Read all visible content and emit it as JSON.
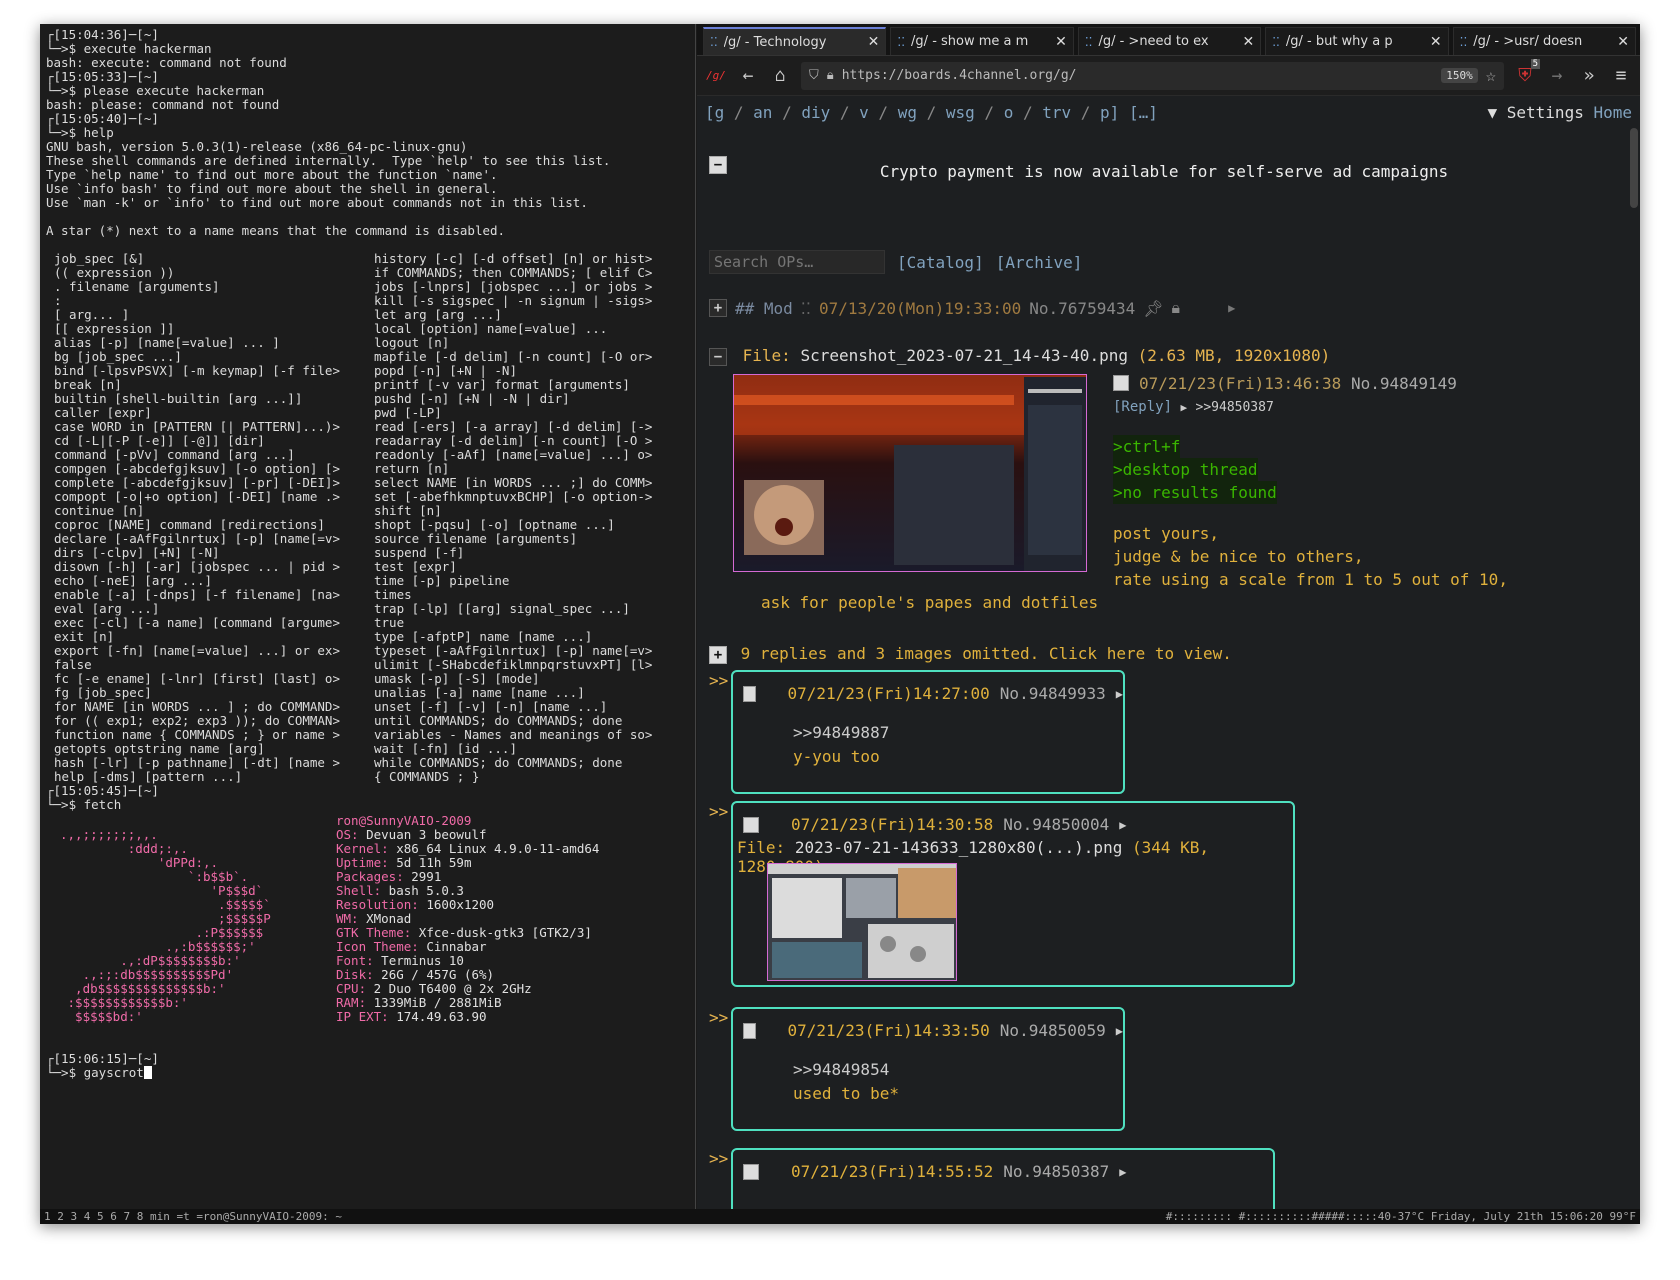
{
  "terminal": {
    "lines_top": [
      {
        "kind": "prompt",
        "text": "┌[15:04:36]─[~]"
      },
      {
        "kind": "cmd",
        "text": "└─>$ execute hackerman"
      },
      {
        "kind": "out",
        "text": "bash: execute: command not found"
      },
      {
        "kind": "prompt",
        "text": "┌[15:05:33]─[~]"
      },
      {
        "kind": "cmd",
        "text": "└─>$ please execute hackerman"
      },
      {
        "kind": "out",
        "text": "bash: please: command not found"
      },
      {
        "kind": "prompt",
        "text": "┌[15:05:40]─[~]"
      },
      {
        "kind": "cmd",
        "text": "└─>$ help"
      },
      {
        "kind": "out",
        "text": "GNU bash, version 5.0.3(1)-release (x86_64-pc-linux-gnu)"
      },
      {
        "kind": "out",
        "text": "These shell commands are defined internally.  Type `help' to see this list."
      },
      {
        "kind": "out",
        "text": "Type `help name' to find out more about the function `name'."
      },
      {
        "kind": "out",
        "text": "Use `info bash' to find out more about the shell in general."
      },
      {
        "kind": "out",
        "text": "Use `man -k' or `info' to find out more about commands not in this list."
      },
      {
        "kind": "out",
        "text": ""
      },
      {
        "kind": "out",
        "text": "A star (*) next to a name means that the command is disabled."
      },
      {
        "kind": "out",
        "text": ""
      }
    ],
    "help_left": [
      "job_spec [&]",
      "(( expression ))",
      ". filename [arguments]",
      ":",
      "[ arg... ]",
      "[[ expression ]]",
      "alias [-p] [name[=value] ... ]",
      "bg [job_spec ...]",
      "bind [-lpsvPSVX] [-m keymap] [-f file>",
      "break [n]",
      "builtin [shell-builtin [arg ...]]",
      "caller [expr]",
      "case WORD in [PATTERN [| PATTERN]...)>",
      "cd [-L|[-P [-e]] [-@]] [dir]",
      "command [-pVv] command [arg ...]",
      "compgen [-abcdefgjksuv] [-o option] [>",
      "complete [-abcdefgjksuv] [-pr] [-DEI]>",
      "compopt [-o|+o option] [-DEI] [name .>",
      "continue [n]",
      "coproc [NAME] command [redirections]",
      "declare [-aAfFgilnrtux] [-p] [name[=v>",
      "dirs [-clpv] [+N] [-N]",
      "disown [-h] [-ar] [jobspec ... | pid >",
      "echo [-neE] [arg ...]",
      "enable [-a] [-dnps] [-f filename] [na>",
      "eval [arg ...]",
      "exec [-cl] [-a name] [command [argume>",
      "exit [n]",
      "export [-fn] [name[=value] ...] or ex>",
      "false",
      "fc [-e ename] [-lnr] [first] [last] o>",
      "fg [job_spec]",
      "for NAME [in WORDS ... ] ; do COMMAND>",
      "for (( exp1; exp2; exp3 )); do COMMAN>",
      "function name { COMMANDS ; } or name >",
      "getopts optstring name [arg]",
      "hash [-lr] [-p pathname] [-dt] [name >",
      "help [-dms] [pattern ...]"
    ],
    "help_right": [
      "history [-c] [-d offset] [n] or hist>",
      "if COMMANDS; then COMMANDS; [ elif C>",
      "jobs [-lnprs] [jobspec ...] or jobs >",
      "kill [-s sigspec | -n signum | -sigs>",
      "let arg [arg ...]",
      "local [option] name[=value] ...",
      "logout [n]",
      "mapfile [-d delim] [-n count] [-O or>",
      "popd [-n] [+N | -N]",
      "printf [-v var] format [arguments]",
      "pushd [-n] [+N | -N | dir]",
      "pwd [-LP]",
      "read [-ers] [-a array] [-d delim] [->",
      "readarray [-d delim] [-n count] [-O >",
      "readonly [-aAf] [name[=value] ...] o>",
      "return [n]",
      "select NAME [in WORDS ... ;] do COMM>",
      "set [-abefhkmnptuvxBCHP] [-o option->",
      "shift [n]",
      "shopt [-pqsu] [-o] [optname ...]",
      "source filename [arguments]",
      "suspend [-f]",
      "test [expr]",
      "time [-p] pipeline",
      "times",
      "trap [-lp] [[arg] signal_spec ...]",
      "true",
      "type [-afptP] name [name ...]",
      "typeset [-aAfFgilnrtux] [-p] name[=v>",
      "ulimit [-SHabcdefiklmnpqrstuvxPT] [l>",
      "umask [-p] [-S] [mode]",
      "unalias [-a] name [name ...]",
      "unset [-f] [-v] [-n] [name ...]",
      "until COMMANDS; do COMMANDS; done",
      "variables - Names and meanings of so>",
      "wait [-fn] [id ...]",
      "while COMMANDS; do COMMANDS; done",
      "{ COMMANDS ; }"
    ],
    "fetch_prompt": "┌[15:05:45]─[~]",
    "fetch_cmd": "└─>$ fetch",
    "fetch_art": [
      "",
      ".,,;;;;;;;,,.",
      "         :ddd;:,.",
      "             'dPPd:,.",
      "                 `:b$$b`.",
      "                    'P$$$d`",
      "                     .$$$$$`",
      "                     ;$$$$$P",
      "                  .:P$$$$$$",
      "              .,:b$$$$$$;'",
      "        .,:dP$$$$$$$$b:'",
      "   .,:;:db$$$$$$$$$$Pd'",
      "  ,db$$$$$$$$$$$$$$b:'",
      " :$$$$$$$$$$$$b:'",
      "  $$$$$bd:'"
    ],
    "fetch_info": [
      {
        "k": "ron@SunnyVAIO-2009",
        "v": ""
      },
      {
        "k": "OS:",
        "v": " Devuan 3 beowulf"
      },
      {
        "k": "Kernel:",
        "v": " x86_64 Linux 4.9.0-11-amd64"
      },
      {
        "k": "Uptime:",
        "v": " 5d 11h 59m"
      },
      {
        "k": "Packages:",
        "v": " 2991"
      },
      {
        "k": "Shell:",
        "v": " bash 5.0.3"
      },
      {
        "k": "Resolution:",
        "v": " 1600x1200"
      },
      {
        "k": "WM:",
        "v": " XMonad"
      },
      {
        "k": "GTK Theme:",
        "v": " Xfce-dusk-gtk3 [GTK2/3]"
      },
      {
        "k": "Icon Theme:",
        "v": " Cinnabar"
      },
      {
        "k": "Font:",
        "v": " Terminus 10"
      },
      {
        "k": "Disk:",
        "v": " 26G / 457G (6%)"
      },
      {
        "k": "CPU:",
        "v": " 2 Duo T6400 @ 2x 2GHz"
      },
      {
        "k": "RAM:",
        "v": " 1339MiB / 2881MiB"
      },
      {
        "k": "IP EXT:",
        "v": " 174.49.63.90"
      }
    ],
    "last_prompt": "┌[15:06:15]─[~]",
    "last_cmd": "└─>$ gayscrot"
  },
  "browser": {
    "tabs": [
      {
        "label": "/g/ - Technology",
        "active": true
      },
      {
        "label": "/g/ - show me a m",
        "active": false
      },
      {
        "label": "/g/ - >need to ex",
        "active": false
      },
      {
        "label": "/g/ - but why a p",
        "active": false
      },
      {
        "label": "/g/ - >usr/ doesn",
        "active": false
      }
    ],
    "url": "https://boards.4channel.org/g/",
    "zoom": "150%",
    "badge": "5",
    "board_nav": [
      "[g",
      "an",
      "diy",
      "v",
      "wg",
      "wsg",
      "o",
      "trv",
      "p]",
      "[…]"
    ],
    "settings": "Settings",
    "home": "Home",
    "announcement": "Crypto payment is now available for self-serve ad campaigns",
    "search_placeholder": "Search OPs…",
    "catalog": "[Catalog]",
    "archive": "[Archive]",
    "op": {
      "name": "## Mod",
      "date": "07/13/20(Mon)19:33:00",
      "no": "No.76759434",
      "file_label": "File:",
      "file_name": "Screenshot_2023-07-21_14-43-40.png",
      "file_meta": "(2.63 MB, 1920x1080)",
      "post_date": "07/21/23(Fri)13:46:38",
      "post_no": "No.94849149",
      "reply": "[Reply]",
      "backlink": ">>94850387",
      "green": [
        ">ctrl+f",
        ">desktop thread",
        ">no results found"
      ],
      "body": [
        "post yours,",
        "judge & be nice to others,",
        "rate using a scale from 1 to 5 out of 10,",
        "ask for people's papes and dotfiles"
      ]
    },
    "omitted": "9 replies and 3 images omitted. Click here to view.",
    "replies": [
      {
        "date": "07/21/23(Fri)14:27:00",
        "no": "No.94849933",
        "quote": ">>94849887",
        "text": "y-you too"
      },
      {
        "date": "07/21/23(Fri)14:30:58",
        "no": "No.94850004",
        "file_label": "File:",
        "file": "2023-07-21-143633_1280x80(...).png",
        "file_meta": "(344 KB, 1280x800)"
      },
      {
        "date": "07/21/23(Fri)14:33:50",
        "no": "No.94850059",
        "quote": ">>94849854",
        "text": "used to be*"
      },
      {
        "date": "07/21/23(Fri)14:55:52",
        "no": "No.94850387"
      }
    ]
  },
  "statusbar": {
    "left": "1 2 3 4 5 6 7 8 min =t =ron@SunnyVAIO-2009: ~",
    "right": "#::::::::: #::::::::::#####:::::40-37°C Friday, July 21th 15:06:20  99°F"
  }
}
